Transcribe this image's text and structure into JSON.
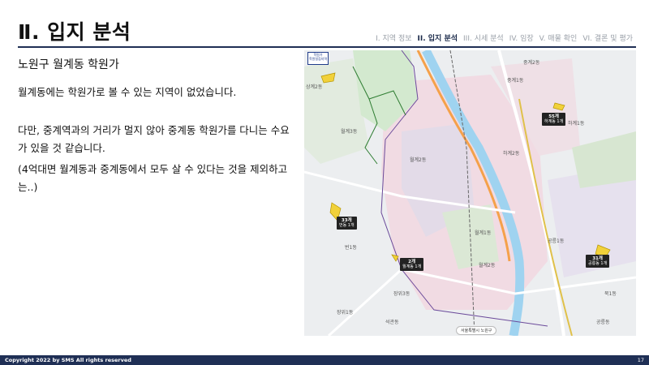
{
  "header": {
    "title": "Ⅱ. 입지 분석",
    "nav": [
      {
        "label": "I. 지역 정보",
        "active": false
      },
      {
        "label": "II. 입지 분석",
        "active": true
      },
      {
        "label": "III. 시세 분석",
        "active": false
      },
      {
        "label": "IV. 임장",
        "active": false
      },
      {
        "label": "V. 매물 확인",
        "active": false
      },
      {
        "label": "VI. 결론 및 평가",
        "active": false
      }
    ]
  },
  "content": {
    "subtitle": "노원구 월계동 학원가",
    "p1": "월계동에는 학원가로 볼 수 있는 지역이 없었습니다.",
    "p2": "다만, 중계역과의 거리가 멀지 않아 중계동 학원가를 다니는 수요가 있을 것 같습니다.",
    "p3": "(4억대면 월계동과 중계동에서 모두 살 수 있다는 것을 제외하고는..)"
  },
  "map": {
    "legend_title": "학원가",
    "legend_sub": "학원밀집지역",
    "district_label": "서울특별시 노원구",
    "place_labels": {
      "l1": "상계2동",
      "l2": "월계2동",
      "l3": "월계3동",
      "l4": "중계1동",
      "l5": "하계2동",
      "l6": "하계1동",
      "l7": "공릉1동",
      "l8": "장위3동",
      "l9": "월계1동",
      "l10": "석관동",
      "l11": "번1동",
      "l12": "장위1동",
      "l13": "공릉동",
      "l14": "묵1동",
      "l15": "중계2동",
      "l16": "월계2동"
    },
    "zones": {
      "z1_count": "55개",
      "z1_name": "하계동 1개",
      "z2_count": "33개",
      "z2_name": "번동 1개",
      "z3_count": "2개",
      "z3_name": "월계동 1개",
      "z4_count": "31개",
      "z4_name": "공릉동 1개"
    }
  },
  "footer": {
    "copyright": "Copyright 2022 by SMS All rights reserved",
    "page": "17"
  }
}
